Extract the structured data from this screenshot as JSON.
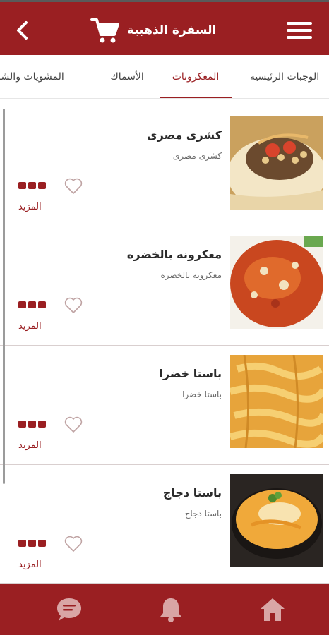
{
  "header": {
    "title": "السفرة الذهبية",
    "icons": {
      "back": "chevron-left-icon",
      "cart": "cart-icon",
      "menu": "hamburger-menu-icon"
    }
  },
  "tabs": [
    {
      "label": "الوجبات الرئيسية",
      "active": false
    },
    {
      "label": "المعكرونات",
      "active": true
    },
    {
      "label": "الأسماك",
      "active": false
    },
    {
      "label": "المشويات والشاورما",
      "active": false
    }
  ],
  "items": [
    {
      "name": "كشرى مصرى",
      "description": "كشرى مصرى",
      "more": "المزيد"
    },
    {
      "name": "معكرونه بالخضره",
      "description": "معكرونه بالخضره",
      "more": "المزيد"
    },
    {
      "name": "باستا خضرا",
      "description": "باستا خضرا",
      "more": "المزيد"
    },
    {
      "name": "باستا دجاج",
      "description": "باستا دجاج",
      "more": "المزيد"
    }
  ],
  "bottom_nav": [
    {
      "icon": "chat-icon"
    },
    {
      "icon": "bell-icon"
    },
    {
      "icon": "home-icon"
    }
  ],
  "colors": {
    "primary": "#9a1f22",
    "background": "#ffffff"
  }
}
